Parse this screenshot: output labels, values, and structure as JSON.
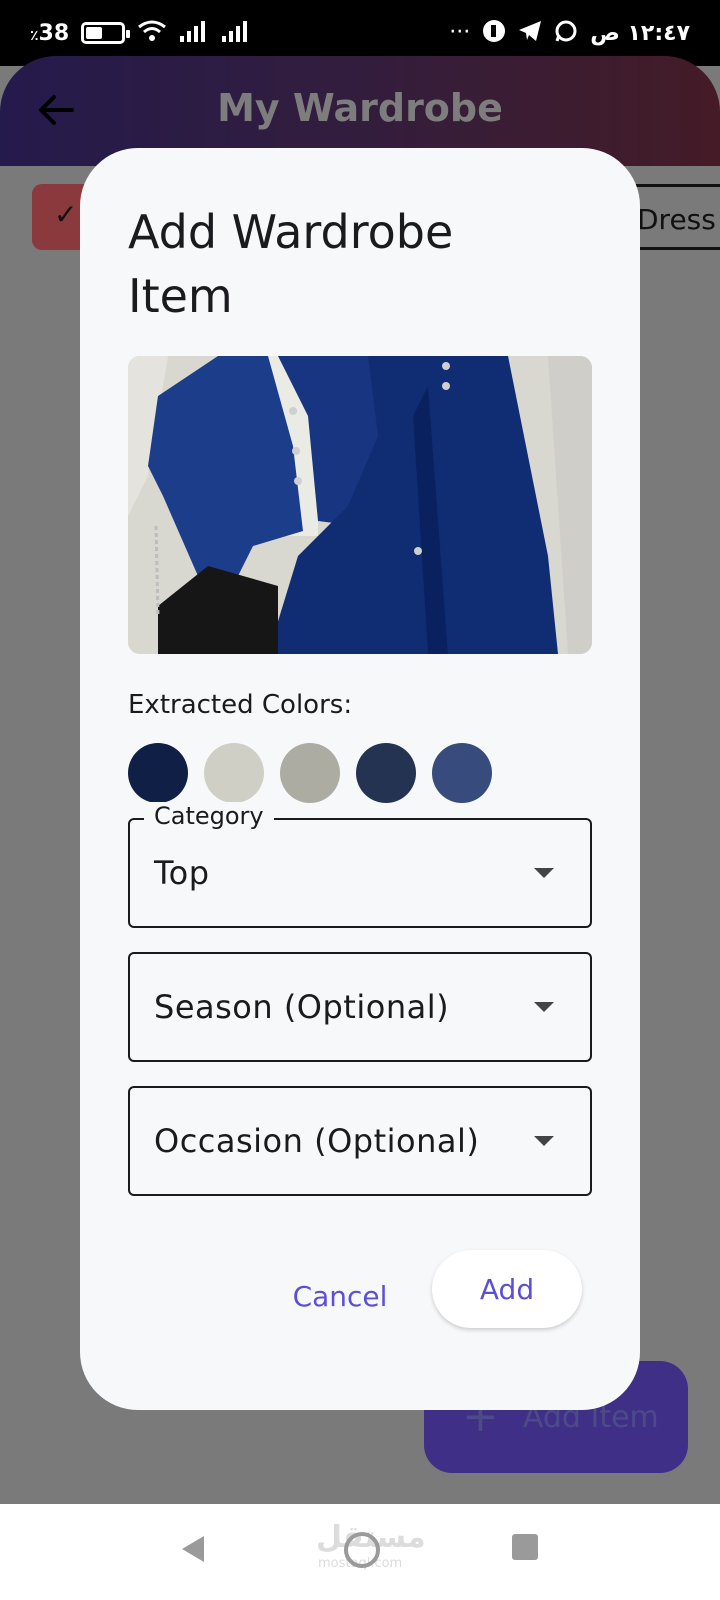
{
  "status_bar": {
    "battery_percent": "38",
    "battery_symbol": "٪",
    "time": "١٢:٤٧ ص",
    "more": "···"
  },
  "app_bar": {
    "title": "My Wardrobe"
  },
  "filter_chips": {
    "selected_check": "✓",
    "dress_label": "Dress"
  },
  "fab": {
    "icon": "+",
    "label": "Add Item"
  },
  "dialog": {
    "title": "Add Wardrobe Item",
    "extracted_colors_label": "Extracted Colors:",
    "extracted_colors": [
      "#0f1f45",
      "#d0cfc5",
      "#adaca2",
      "#253352",
      "#384b7d"
    ],
    "category": {
      "label": "Category",
      "value": "Top"
    },
    "season": {
      "placeholder": "Season (Optional)"
    },
    "occasion": {
      "placeholder": "Occasion (Optional)"
    },
    "cancel_label": "Cancel",
    "add_label": "Add"
  },
  "watermark": {
    "main": "مستقل",
    "sub": "mostaql.com"
  }
}
